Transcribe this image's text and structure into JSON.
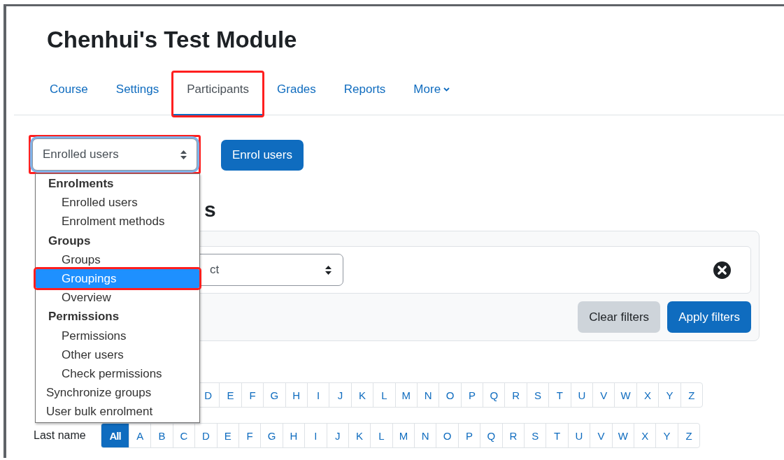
{
  "page": {
    "title": "Chenhui's Test Module"
  },
  "tabs": [
    {
      "label": "Course",
      "selected": false,
      "annotated": false
    },
    {
      "label": "Settings",
      "selected": false,
      "annotated": false
    },
    {
      "label": "Participants",
      "selected": true,
      "annotated": true
    },
    {
      "label": "Grades",
      "selected": false,
      "annotated": false
    },
    {
      "label": "Reports",
      "selected": false,
      "annotated": false
    },
    {
      "label": "More",
      "selected": false,
      "annotated": false,
      "kind": "dropdown"
    }
  ],
  "navigation_select": {
    "value": "Enrolled users",
    "annotated": true
  },
  "enrol_button": {
    "label": "Enrol users"
  },
  "heading": {
    "text": "s"
  },
  "filter": {
    "select_value": "ct",
    "clear_button": "Clear filters",
    "apply_button": "Apply filters"
  },
  "menu": {
    "items": [
      {
        "kind": "group",
        "label": "Enrolments",
        "children": [
          {
            "label": "Enrolled users",
            "selected": false,
            "annotated": false
          },
          {
            "label": "Enrolment methods",
            "selected": false,
            "annotated": false
          }
        ]
      },
      {
        "kind": "group",
        "label": "Groups",
        "children": [
          {
            "label": "Groups",
            "selected": false,
            "annotated": false
          },
          {
            "label": "Groupings",
            "selected": true,
            "annotated": true
          },
          {
            "label": "Overview",
            "selected": false,
            "annotated": false
          }
        ]
      },
      {
        "kind": "group",
        "label": "Permissions",
        "children": [
          {
            "label": "Permissions",
            "selected": false,
            "annotated": false
          },
          {
            "label": "Other users",
            "selected": false,
            "annotated": false
          },
          {
            "label": "Check permissions",
            "selected": false,
            "annotated": false
          }
        ]
      },
      {
        "kind": "option",
        "label": "Synchronize groups",
        "selected": false,
        "annotated": false
      },
      {
        "kind": "option",
        "label": "User bulk enrolment",
        "selected": false,
        "annotated": false
      }
    ]
  },
  "initials_bars": [
    {
      "letters": [
        {
          "text": "D",
          "selected": false
        },
        {
          "text": "E",
          "selected": false
        },
        {
          "text": "F",
          "selected": false
        },
        {
          "text": "G",
          "selected": false
        },
        {
          "text": "H",
          "selected": false
        },
        {
          "text": "I",
          "selected": false
        },
        {
          "text": "J",
          "selected": false
        },
        {
          "text": "K",
          "selected": false
        },
        {
          "text": "L",
          "selected": false
        },
        {
          "text": "M",
          "selected": false
        },
        {
          "text": "N",
          "selected": false
        },
        {
          "text": "O",
          "selected": false
        },
        {
          "text": "P",
          "selected": false
        },
        {
          "text": "Q",
          "selected": false
        },
        {
          "text": "R",
          "selected": false
        },
        {
          "text": "S",
          "selected": false
        },
        {
          "text": "T",
          "selected": false
        },
        {
          "text": "U",
          "selected": false
        },
        {
          "text": "V",
          "selected": false
        },
        {
          "text": "W",
          "selected": false
        },
        {
          "text": "X",
          "selected": false
        },
        {
          "text": "Y",
          "selected": false
        },
        {
          "text": "Z",
          "selected": false
        }
      ]
    },
    {
      "label": "Last name",
      "letters": [
        {
          "text": "All",
          "selected": true
        },
        {
          "text": "A",
          "selected": false
        },
        {
          "text": "B",
          "selected": false
        },
        {
          "text": "C",
          "selected": false
        },
        {
          "text": "D",
          "selected": false
        },
        {
          "text": "E",
          "selected": false
        },
        {
          "text": "F",
          "selected": false
        },
        {
          "text": "G",
          "selected": false
        },
        {
          "text": "H",
          "selected": false
        },
        {
          "text": "I",
          "selected": false
        },
        {
          "text": "J",
          "selected": false
        },
        {
          "text": "K",
          "selected": false
        },
        {
          "text": "L",
          "selected": false
        },
        {
          "text": "M",
          "selected": false
        },
        {
          "text": "N",
          "selected": false
        },
        {
          "text": "O",
          "selected": false
        },
        {
          "text": "P",
          "selected": false
        },
        {
          "text": "Q",
          "selected": false
        },
        {
          "text": "R",
          "selected": false
        },
        {
          "text": "S",
          "selected": false
        },
        {
          "text": "T",
          "selected": false
        },
        {
          "text": "U",
          "selected": false
        },
        {
          "text": "V",
          "selected": false
        },
        {
          "text": "W",
          "selected": false
        },
        {
          "text": "X",
          "selected": false
        },
        {
          "text": "Y",
          "selected": false
        },
        {
          "text": "Z",
          "selected": false
        }
      ]
    }
  ]
}
